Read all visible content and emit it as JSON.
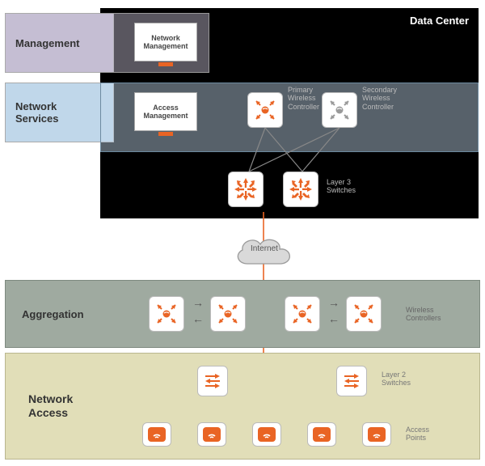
{
  "dc_label": "Data Center",
  "bands": {
    "mgmt": "Management",
    "svc": "Network\nServices",
    "agg": "Aggregation",
    "acc": "Network\nAccess"
  },
  "monitors": {
    "netmgmt": "Network Management",
    "accmgmt": "Access Management"
  },
  "labels": {
    "pwc": "Primary\nWireless\nController",
    "swc": "Secondary\nWireless\nController",
    "l3": "Layer 3\nSwitches",
    "l2": "Layer 2\nSwitches",
    "wctrl": "Wireless\nControllers",
    "ap": "Access\nPoints"
  },
  "cloud": "Internet",
  "colors": {
    "orange": "#e96424",
    "gray": "#9a9a9a"
  }
}
